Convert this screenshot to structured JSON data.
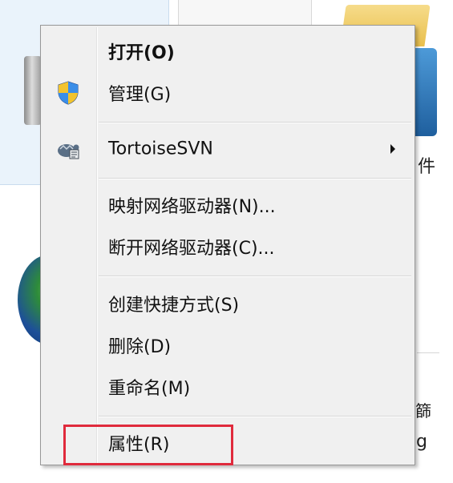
{
  "background": {
    "fragment_1": "件",
    "fragment_2": "篩",
    "fragment_3": "g"
  },
  "context_menu": {
    "items": [
      {
        "label": "打开(O)",
        "icon": null,
        "bold": true
      },
      {
        "label": "管理(G)",
        "icon": "uac-shield-icon"
      },
      {
        "label": "TortoiseSVN",
        "icon": "tortoisesvn-icon",
        "submenu": true
      },
      {
        "label": "映射网络驱动器(N)..."
      },
      {
        "label": "断开网络驱动器(C)..."
      },
      {
        "label": "创建快捷方式(S)"
      },
      {
        "label": "删除(D)"
      },
      {
        "label": "重命名(M)"
      },
      {
        "label": "属性(R)"
      }
    ]
  },
  "colors": {
    "menu_background": "#f0f0f0",
    "menu_border": "#979797",
    "highlight_box": "#e02a3c",
    "text": "#111111"
  }
}
